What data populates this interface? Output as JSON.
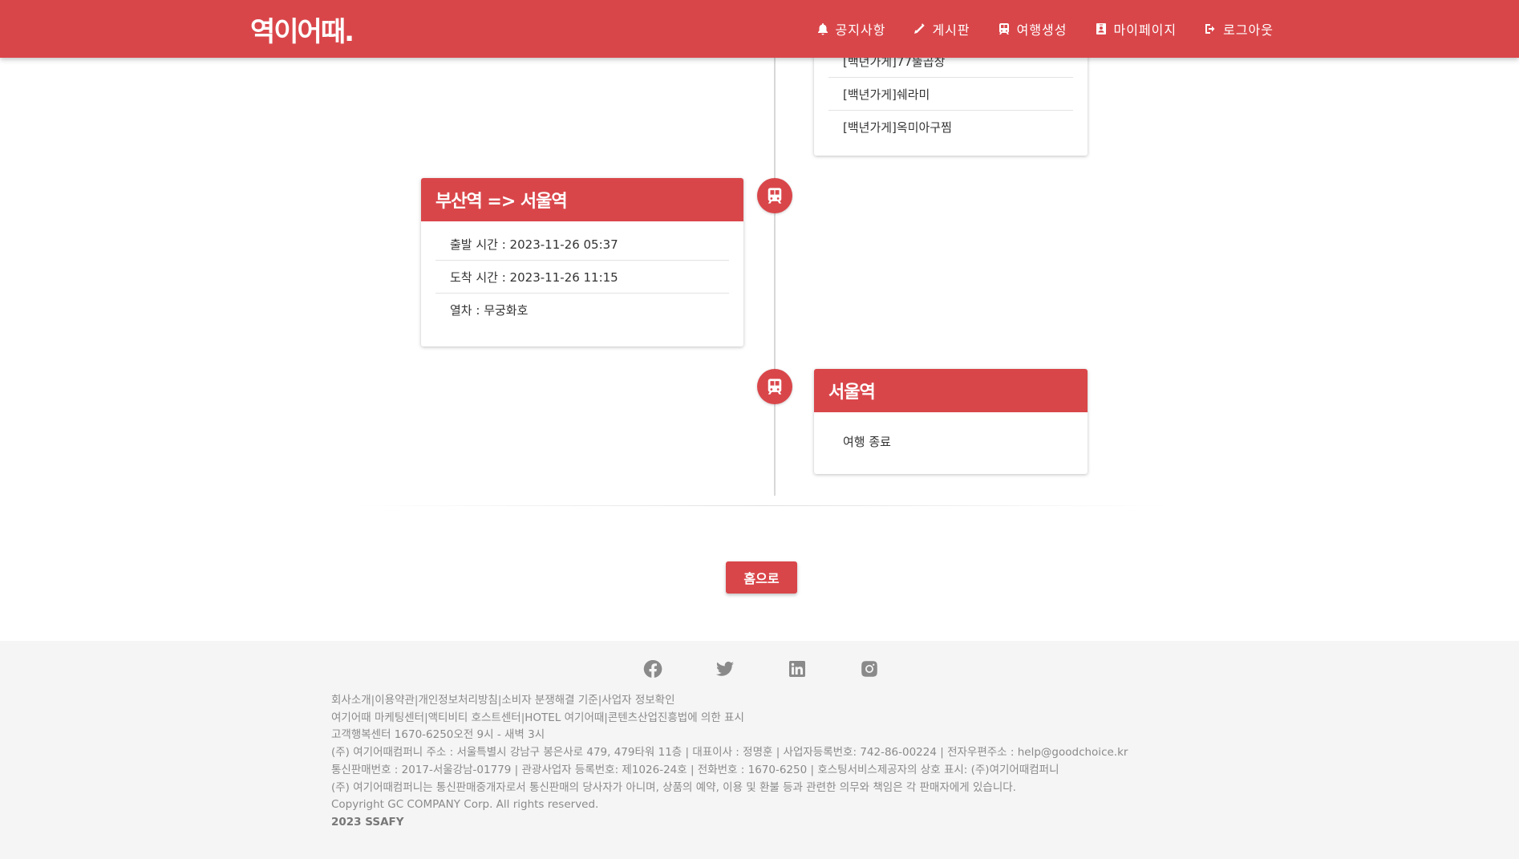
{
  "header": {
    "brand": "역이어때.",
    "nav": [
      {
        "label": "공지사항",
        "icon": "bell-icon"
      },
      {
        "label": "게시판",
        "icon": "pencil-icon"
      },
      {
        "label": "여행생성",
        "icon": "train-icon"
      },
      {
        "label": "마이페이지",
        "icon": "id-badge-icon"
      },
      {
        "label": "로그아웃",
        "icon": "sign-out-icon"
      }
    ]
  },
  "timeline": {
    "top_card": {
      "items": [
        "[백년가게]77뚤곱창",
        "[백년가게]쉐라미",
        "[백년가게]옥미아구찜"
      ]
    },
    "route_card": {
      "title": "부산역 => 서울역",
      "items": [
        "출발 시간 : 2023-11-26 05:37",
        "도착 시간 : 2023-11-26 11:15",
        "열차 : 무궁화호"
      ]
    },
    "end_card": {
      "title": "서울역",
      "items": [
        "여행 종료"
      ]
    }
  },
  "home_button": "홈으로",
  "footer": {
    "social": [
      "facebook-icon",
      "twitter-icon",
      "linkedin-icon",
      "instagram-icon"
    ],
    "lines": [
      "회사소개|이용약관|개인정보처리방침|소비자 분쟁해결 기준|사업자 정보확인",
      "여기어때 마케팅센터|액티비티 호스트센터|HOTEL 여기어때|콘텐츠산업진흥법에 의한 표시",
      "고객행복센터 1670-6250오전 9시 - 새벽 3시",
      "(주) 여기어때컴퍼니 주소 : 서울특별시 강남구 봉은사로 479, 479타워 11층 | 대표이사 : 정명훈 | 사업자등록번호: 742-86-00224 | 전자우편주소 : help@goodchoice.kr",
      "통신판매번호 : 2017-서울강남-01779 | 관광사업자 등록번호: 제1026-24호 | 전화번호 : 1670-6250 | 호스팅서비스제공자의 상호 표시: (주)여기어때컴퍼니",
      "(주) 여기어때컴퍼니는 통신판매중개자로서 통신판매의 당사자가 아니며, 상품의 예약, 이용 및 환불 등과 관련한 의무와 책임은 각 판매자에게 있습니다.",
      "Copyright GC COMPANY Corp. All rights reserved."
    ],
    "year_line": "2023 SSAFY"
  }
}
